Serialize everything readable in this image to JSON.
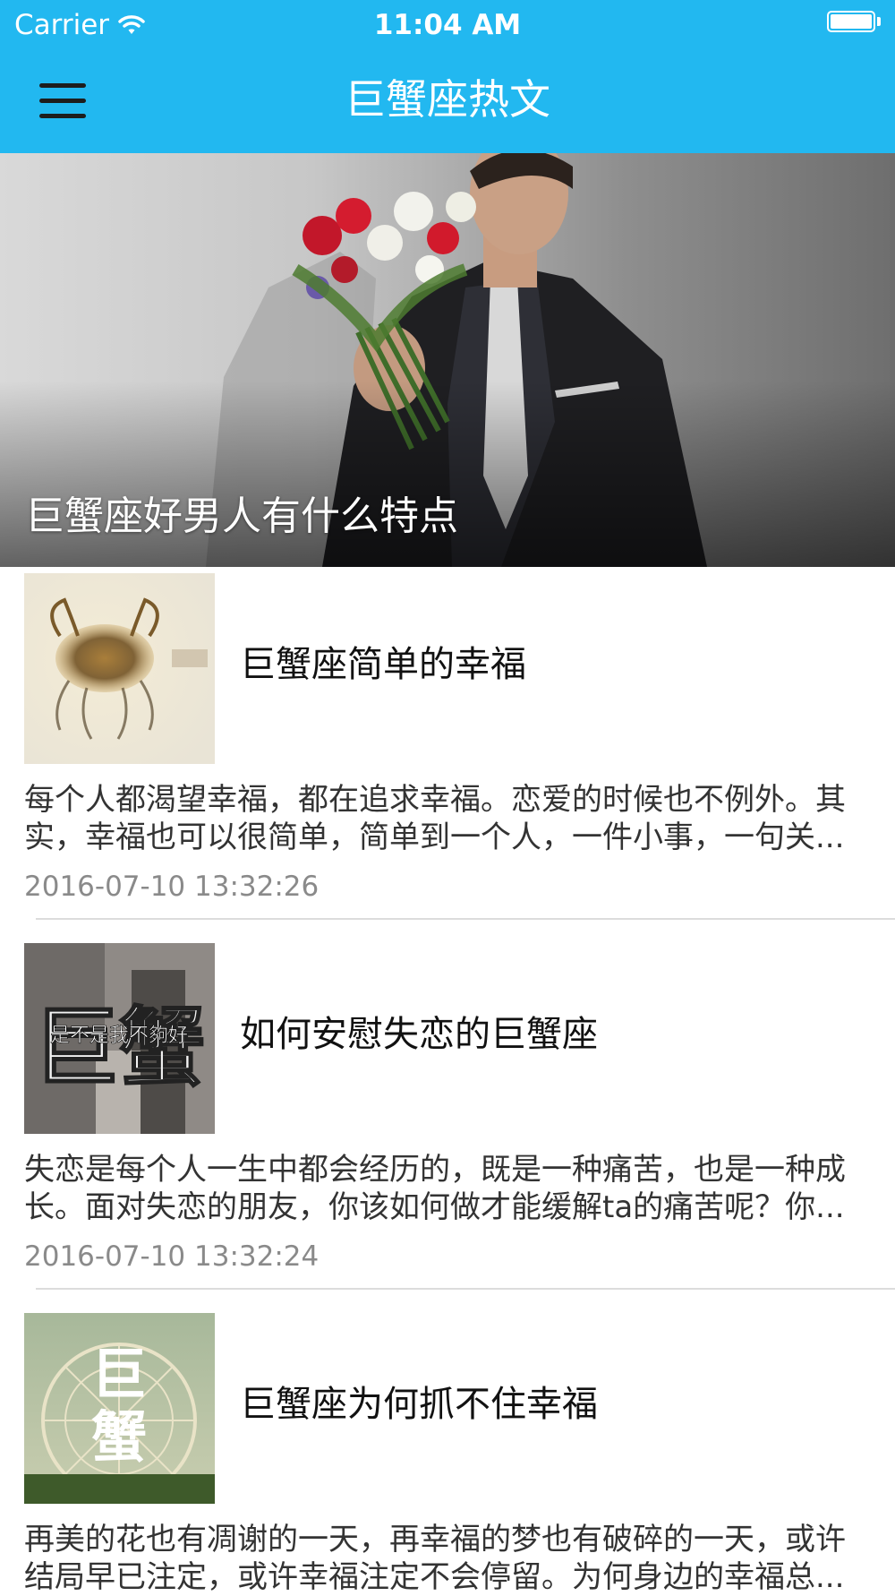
{
  "status_bar": {
    "carrier": "Carrier",
    "time": "11:04 AM"
  },
  "nav": {
    "title": "巨蟹座热文",
    "menu_icon": "hamburger-menu-icon"
  },
  "hero": {
    "caption": "巨蟹座好男人有什么特点",
    "image": "man-in-suit-holding-bouquet"
  },
  "articles": [
    {
      "title": "巨蟹座简单的幸福",
      "summary_line1": "每个人都渴望幸福，都在追求幸福。恋爱的时候也不例外。其",
      "summary_line2": "实，幸福也可以很简单，简单到一个人，一件小事，一句关...",
      "date": "2016-07-10 13:32:26",
      "thumb_image": "golden-crab-artwork"
    },
    {
      "title": "如何安慰失恋的巨蟹座",
      "summary_line1": "失恋是每个人一生中都会经历的，既是一种痛苦，也是一种成",
      "summary_line2": "长。面对失恋的朋友，你该如何做才能缓解ta的痛苦呢？你...",
      "date": "2016-07-10 13:32:24",
      "thumb_image": "crab-text-over-photo",
      "thumb_text_big": "巨蟹",
      "thumb_text_small": "是不是我不夠好"
    },
    {
      "title": "巨蟹座为何抓不住幸福",
      "summary_line1": "再美的花也有凋谢的一天，再幸福的梦也有破碎的一天，或许",
      "summary_line2": "结局早已注定，或许幸福注定不会停留。为何身边的幸福总...",
      "thumb_image": "ferris-wheel-with-crab-text",
      "thumb_text_big_1": "巨",
      "thumb_text_big_2": "蟹"
    }
  ],
  "colors": {
    "header_bg": "#22b8f0",
    "date_text": "#8a8a8a",
    "divider": "#dcdcdc"
  }
}
